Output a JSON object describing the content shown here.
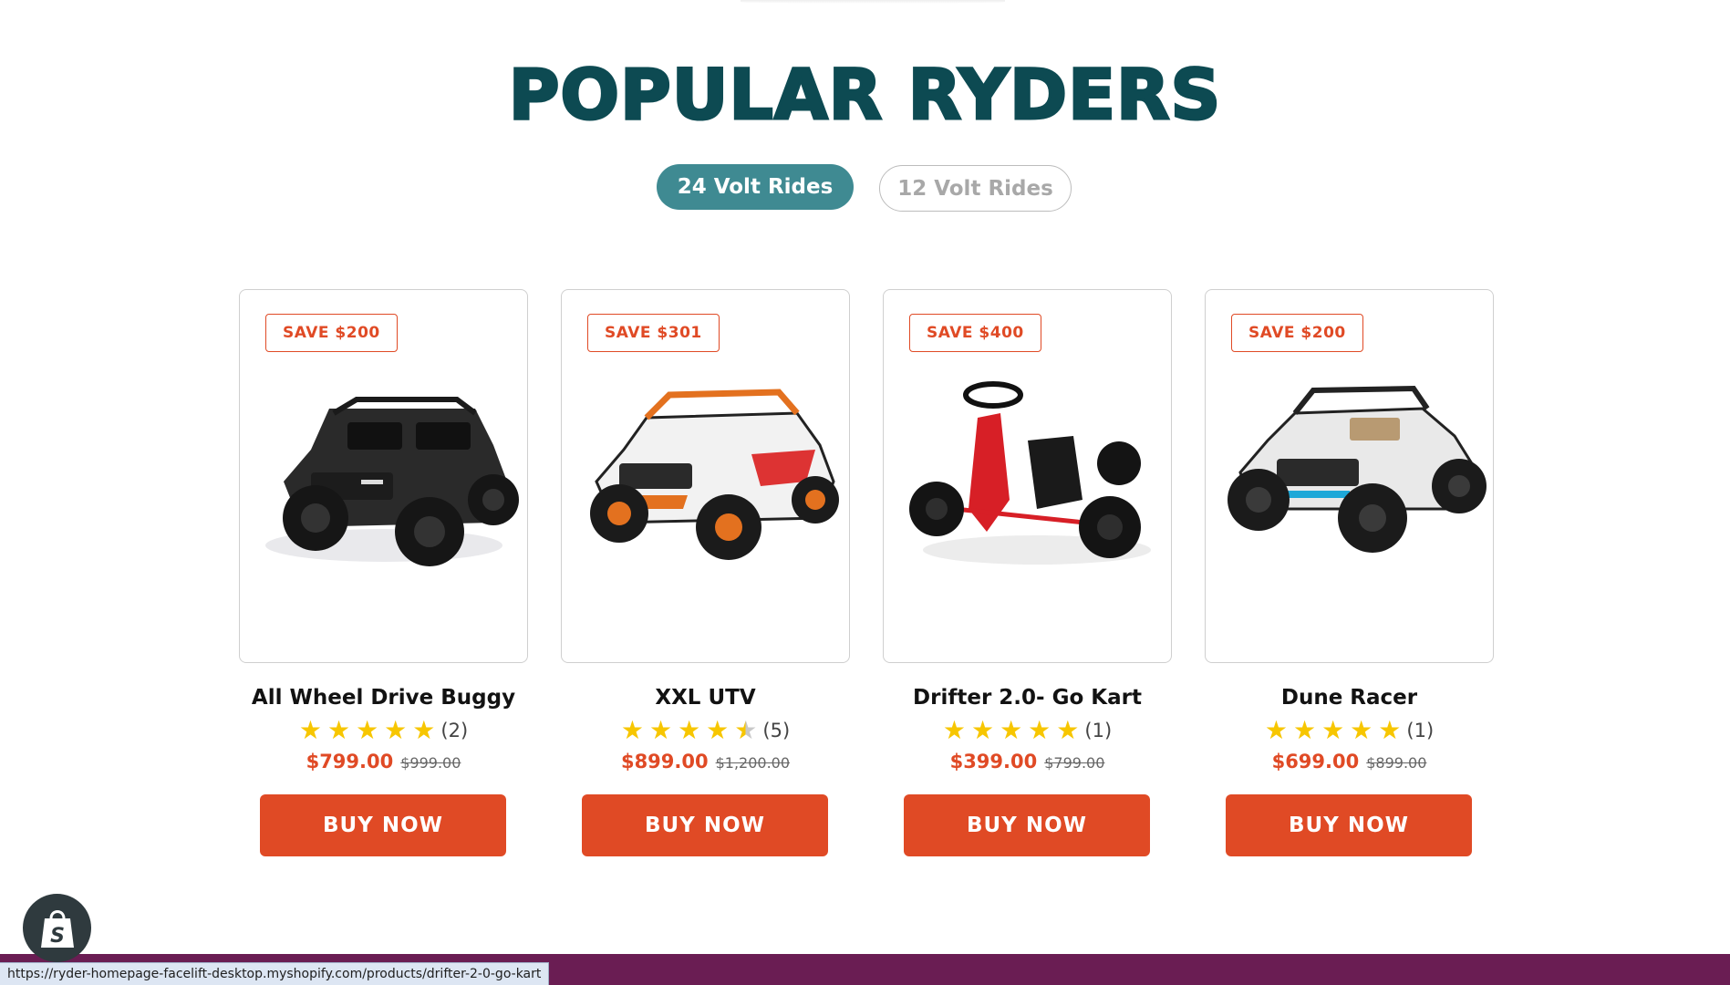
{
  "section": {
    "title": "POPULAR RYDERS"
  },
  "tabs": [
    {
      "label": "24 Volt Rides",
      "active": true
    },
    {
      "label": "12 Volt Rides",
      "active": false
    }
  ],
  "products": [
    {
      "badge": "SAVE $200",
      "title": "All Wheel Drive Buggy",
      "rating": 5,
      "review_count": "(2)",
      "price": "$799.00",
      "compare_price": "$999.00",
      "button": "BUY NOW",
      "image": "black-buggy-image"
    },
    {
      "badge": "SAVE $301",
      "title": "XXL UTV",
      "rating": 4.5,
      "review_count": "(5)",
      "price": "$899.00",
      "compare_price": "$1,200.00",
      "button": "BUY NOW",
      "image": "orange-utv-image"
    },
    {
      "badge": "SAVE $400",
      "title": "Drifter 2.0- Go Kart",
      "rating": 5,
      "review_count": "(1)",
      "price": "$399.00",
      "compare_price": "$799.00",
      "button": "BUY NOW",
      "image": "red-go-kart-image"
    },
    {
      "badge": "SAVE $200",
      "title": "Dune Racer",
      "rating": 5,
      "review_count": "(1)",
      "price": "$699.00",
      "compare_price": "$899.00",
      "button": "BUY NOW",
      "image": "white-dune-racer-image"
    }
  ],
  "colors": {
    "title": "#0d4a52",
    "tab_active": "#3f8a92",
    "accent": "#e04a25",
    "star": "#f7c600",
    "footer": "#6a1d53"
  },
  "status_bar": {
    "url": "https://ryder-homepage-facelift-desktop.myshopify.com/products/drifter-2-0-go-kart"
  },
  "floating": {
    "icon": "shopify-bag-icon"
  }
}
